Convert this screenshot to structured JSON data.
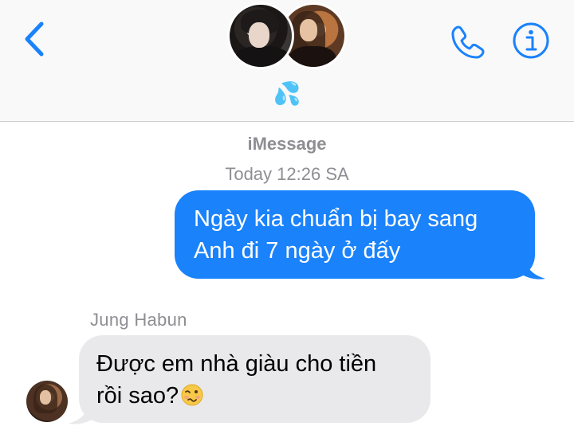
{
  "header": {
    "group_name": "💦",
    "back_icon": "chevron-left-icon",
    "call_icon": "phone-icon",
    "info_icon": "info-icon",
    "accent_color": "#1a82fb"
  },
  "conversation": {
    "service_label": "iMessage",
    "timestamp": "Today 12:26 SA",
    "messages": [
      {
        "direction": "sent",
        "lines": [
          "Ngày kia chuẩn bị bay sang",
          "Anh đi 7 ngày ở đấy"
        ],
        "bubble_color": "#1a82fb"
      },
      {
        "direction": "received",
        "sender": "Jung Habun",
        "lines": [
          "Được em nhà giàu cho tiền",
          "rồi sao?"
        ],
        "emoji": "woozy-face-emoji",
        "bubble_color": "#e9e9eb"
      }
    ]
  }
}
